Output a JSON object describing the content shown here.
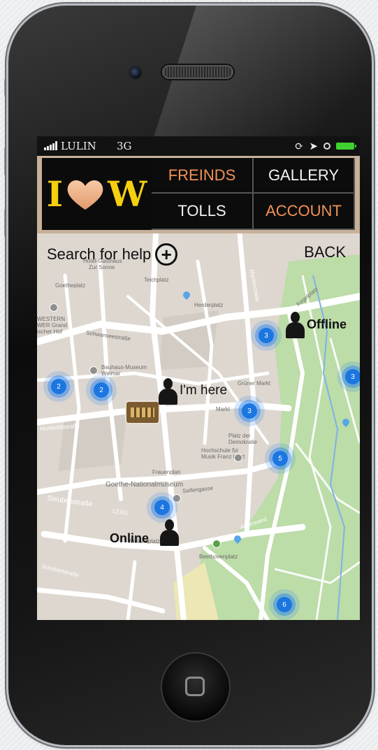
{
  "status_bar": {
    "carrier": "LULIN",
    "network": "3G",
    "icons": [
      "signal-bars-icon",
      "rotation-lock-icon",
      "location-arrow-icon",
      "alarm-icon",
      "battery-icon"
    ]
  },
  "header": {
    "logo": {
      "left_letter": "I",
      "right_letter": "W",
      "heart_icon": "heart-icon"
    },
    "menu": {
      "friends": "FREINDS",
      "gallery": "GALLERY",
      "tolls": "TOLLS",
      "account": "ACCOUNT"
    }
  },
  "map": {
    "search_label": "Search for help",
    "search_icon": "plus-circle-icon",
    "back_label": "BACK",
    "users": [
      {
        "label": "Offline"
      },
      {
        "label": "I'm here"
      },
      {
        "label": "Online"
      }
    ],
    "clusters": [
      "3",
      "2",
      "2",
      "3",
      "3",
      "5",
      "4",
      "6"
    ],
    "street_labels": [
      "Hotel-Gasthaus",
      "Zur Sonne",
      "Goetheplatz",
      "Teichplatz",
      "Herderplatz",
      "WESTERN",
      "WER Grand",
      "ischer Hof",
      "Schwanseestraße",
      "Bauhaus-Museum",
      "Weimar",
      "Markt",
      "Grüner Markt",
      "Platz der",
      "Demokratie",
      "Hochschule für",
      "Musik Franz Liszt",
      "Frauenplan",
      "Goethe-Nationalmuseum",
      "Seifengasse",
      "Steubenstraße",
      "L2161",
      "Wielandplatz",
      "Ackerwand",
      "Beethovenplatz",
      "Humboldtstraße",
      "Schubertstraße",
      "Marienstraße",
      "Kegelplatz"
    ]
  },
  "colors": {
    "menu_orange": "#f29255",
    "menu_white": "#f3f3f3",
    "logo_yellow": "#f5cf10",
    "cluster_blue": "#1b76e0",
    "park_green": "#bcdca8"
  }
}
